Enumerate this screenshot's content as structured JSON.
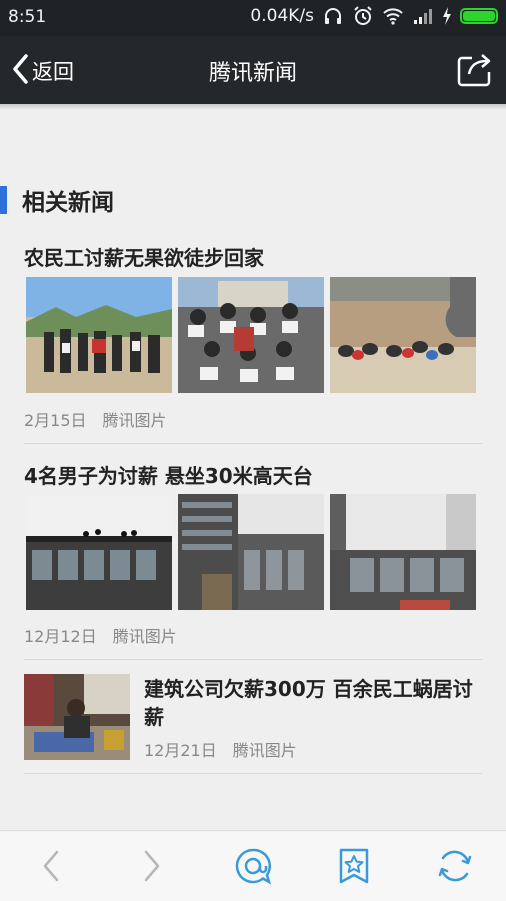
{
  "status_bar": {
    "time": "8:51",
    "net_speed": "0.04K/s"
  },
  "nav": {
    "back_label": "返回",
    "title": "腾讯新闻"
  },
  "section": {
    "title": "相关新闻"
  },
  "news": [
    {
      "title": "农民工讨薪无果欲徒步回家",
      "date": "2月15日",
      "source": "腾讯图片"
    },
    {
      "title": "4名男子为讨薪 悬坐30米高天台",
      "date": "12月12日",
      "source": "腾讯图片"
    },
    {
      "title": "建筑公司欠薪300万 百余民工蜗居讨薪",
      "date": "12月21日",
      "source": "腾讯图片"
    }
  ],
  "colors": {
    "accent": "#2e6fd8",
    "toolbar_icon": "#3a9ad9",
    "battery": "#2bd52b"
  }
}
